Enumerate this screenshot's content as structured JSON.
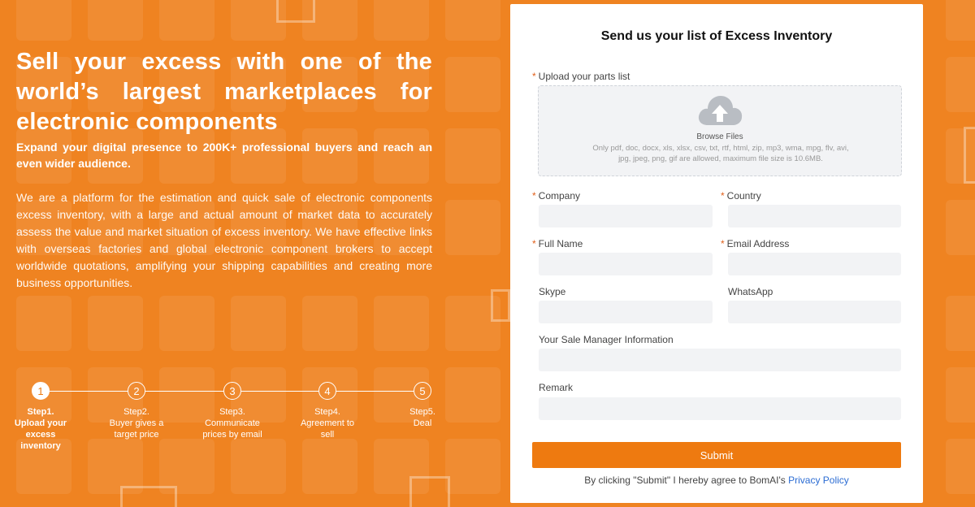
{
  "hero": {
    "headline": "Sell your excess with one of the world’s largest marketplaces for electronic components",
    "subheadline": "Expand your digital presence to 200K+ professional buyers and reach an even wider audience.",
    "description": "We are a platform for the estimation and quick sale of electronic components excess inventory, with a large and actual amount of market data to accurately assess the value and market situation of excess inventory. We have effective links with overseas factories and global electronic component brokers to accept worldwide quotations, amplifying your shipping capabilities and creating more business opportunities."
  },
  "steps": [
    {
      "number": "1",
      "label": "Step1.\nUpload your excess inventory",
      "active": true
    },
    {
      "number": "2",
      "label": "Step2.\nBuyer gives a target price",
      "active": false
    },
    {
      "number": "3",
      "label": "Step3.\nCommunicate prices by email",
      "active": false
    },
    {
      "number": "4",
      "label": "Step4.\nAgreement to sell",
      "active": false
    },
    {
      "number": "5",
      "label": "Step5.\nDeal",
      "active": false
    }
  ],
  "form": {
    "title": "Send us your list of Excess Inventory",
    "upload": {
      "label": "Upload your parts list",
      "button": "Browse Files",
      "note": "Only pdf, doc, docx, xls, xlsx, csv, txt, rtf, html, zip, mp3, wma, mpg, flv, avi, jpg, jpeg, png, gif are allowed, maximum file size is 10.6MB."
    },
    "fields": {
      "company": {
        "label": "Company",
        "required": true,
        "value": ""
      },
      "country": {
        "label": "Country",
        "required": true,
        "value": ""
      },
      "full_name": {
        "label": "Full Name",
        "required": true,
        "value": ""
      },
      "email": {
        "label": "Email Address",
        "required": true,
        "value": ""
      },
      "skype": {
        "label": "Skype",
        "required": false,
        "value": ""
      },
      "whatsapp": {
        "label": "WhatsApp",
        "required": false,
        "value": ""
      },
      "sale_manager": {
        "label": "Your Sale Manager Information",
        "required": false,
        "value": ""
      },
      "remark": {
        "label": "Remark",
        "required": false,
        "value": ""
      }
    },
    "required_mark": "*",
    "submit_label": "Submit",
    "agreement_text": "By clicking \"Submit\" I hereby agree to BomAI's",
    "privacy_link": "Privacy Policy"
  },
  "colors": {
    "brand_orange": "#ee7a10",
    "link_blue": "#2b6cd3",
    "required_mark": "#e0601b"
  }
}
